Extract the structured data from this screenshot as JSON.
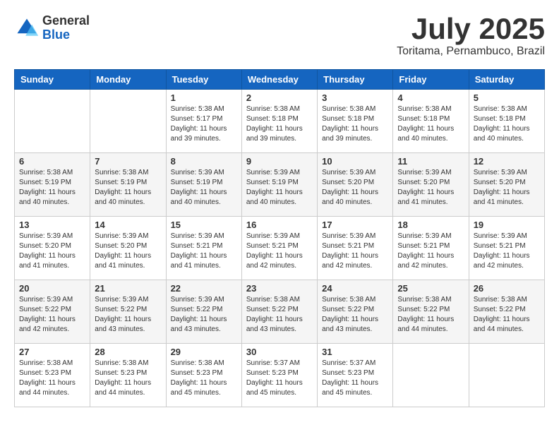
{
  "header": {
    "logo_general": "General",
    "logo_blue": "Blue",
    "month": "July 2025",
    "location": "Toritama, Pernambuco, Brazil"
  },
  "days_of_week": [
    "Sunday",
    "Monday",
    "Tuesday",
    "Wednesday",
    "Thursday",
    "Friday",
    "Saturday"
  ],
  "weeks": [
    [
      {
        "day": null
      },
      {
        "day": null
      },
      {
        "day": 1,
        "sunrise": "5:38 AM",
        "sunset": "5:17 PM",
        "daylight": "11 hours and 39 minutes."
      },
      {
        "day": 2,
        "sunrise": "5:38 AM",
        "sunset": "5:18 PM",
        "daylight": "11 hours and 39 minutes."
      },
      {
        "day": 3,
        "sunrise": "5:38 AM",
        "sunset": "5:18 PM",
        "daylight": "11 hours and 39 minutes."
      },
      {
        "day": 4,
        "sunrise": "5:38 AM",
        "sunset": "5:18 PM",
        "daylight": "11 hours and 40 minutes."
      },
      {
        "day": 5,
        "sunrise": "5:38 AM",
        "sunset": "5:18 PM",
        "daylight": "11 hours and 40 minutes."
      }
    ],
    [
      {
        "day": 6,
        "sunrise": "5:38 AM",
        "sunset": "5:19 PM",
        "daylight": "11 hours and 40 minutes."
      },
      {
        "day": 7,
        "sunrise": "5:38 AM",
        "sunset": "5:19 PM",
        "daylight": "11 hours and 40 minutes."
      },
      {
        "day": 8,
        "sunrise": "5:39 AM",
        "sunset": "5:19 PM",
        "daylight": "11 hours and 40 minutes."
      },
      {
        "day": 9,
        "sunrise": "5:39 AM",
        "sunset": "5:19 PM",
        "daylight": "11 hours and 40 minutes."
      },
      {
        "day": 10,
        "sunrise": "5:39 AM",
        "sunset": "5:20 PM",
        "daylight": "11 hours and 40 minutes."
      },
      {
        "day": 11,
        "sunrise": "5:39 AM",
        "sunset": "5:20 PM",
        "daylight": "11 hours and 41 minutes."
      },
      {
        "day": 12,
        "sunrise": "5:39 AM",
        "sunset": "5:20 PM",
        "daylight": "11 hours and 41 minutes."
      }
    ],
    [
      {
        "day": 13,
        "sunrise": "5:39 AM",
        "sunset": "5:20 PM",
        "daylight": "11 hours and 41 minutes."
      },
      {
        "day": 14,
        "sunrise": "5:39 AM",
        "sunset": "5:20 PM",
        "daylight": "11 hours and 41 minutes."
      },
      {
        "day": 15,
        "sunrise": "5:39 AM",
        "sunset": "5:21 PM",
        "daylight": "11 hours and 41 minutes."
      },
      {
        "day": 16,
        "sunrise": "5:39 AM",
        "sunset": "5:21 PM",
        "daylight": "11 hours and 42 minutes."
      },
      {
        "day": 17,
        "sunrise": "5:39 AM",
        "sunset": "5:21 PM",
        "daylight": "11 hours and 42 minutes."
      },
      {
        "day": 18,
        "sunrise": "5:39 AM",
        "sunset": "5:21 PM",
        "daylight": "11 hours and 42 minutes."
      },
      {
        "day": 19,
        "sunrise": "5:39 AM",
        "sunset": "5:21 PM",
        "daylight": "11 hours and 42 minutes."
      }
    ],
    [
      {
        "day": 20,
        "sunrise": "5:39 AM",
        "sunset": "5:22 PM",
        "daylight": "11 hours and 42 minutes."
      },
      {
        "day": 21,
        "sunrise": "5:39 AM",
        "sunset": "5:22 PM",
        "daylight": "11 hours and 43 minutes."
      },
      {
        "day": 22,
        "sunrise": "5:39 AM",
        "sunset": "5:22 PM",
        "daylight": "11 hours and 43 minutes."
      },
      {
        "day": 23,
        "sunrise": "5:38 AM",
        "sunset": "5:22 PM",
        "daylight": "11 hours and 43 minutes."
      },
      {
        "day": 24,
        "sunrise": "5:38 AM",
        "sunset": "5:22 PM",
        "daylight": "11 hours and 43 minutes."
      },
      {
        "day": 25,
        "sunrise": "5:38 AM",
        "sunset": "5:22 PM",
        "daylight": "11 hours and 44 minutes."
      },
      {
        "day": 26,
        "sunrise": "5:38 AM",
        "sunset": "5:22 PM",
        "daylight": "11 hours and 44 minutes."
      }
    ],
    [
      {
        "day": 27,
        "sunrise": "5:38 AM",
        "sunset": "5:23 PM",
        "daylight": "11 hours and 44 minutes."
      },
      {
        "day": 28,
        "sunrise": "5:38 AM",
        "sunset": "5:23 PM",
        "daylight": "11 hours and 44 minutes."
      },
      {
        "day": 29,
        "sunrise": "5:38 AM",
        "sunset": "5:23 PM",
        "daylight": "11 hours and 45 minutes."
      },
      {
        "day": 30,
        "sunrise": "5:37 AM",
        "sunset": "5:23 PM",
        "daylight": "11 hours and 45 minutes."
      },
      {
        "day": 31,
        "sunrise": "5:37 AM",
        "sunset": "5:23 PM",
        "daylight": "11 hours and 45 minutes."
      },
      {
        "day": null
      },
      {
        "day": null
      }
    ]
  ],
  "labels": {
    "sunrise_prefix": "Sunrise: ",
    "sunset_prefix": "Sunset: ",
    "daylight_prefix": "Daylight: "
  }
}
